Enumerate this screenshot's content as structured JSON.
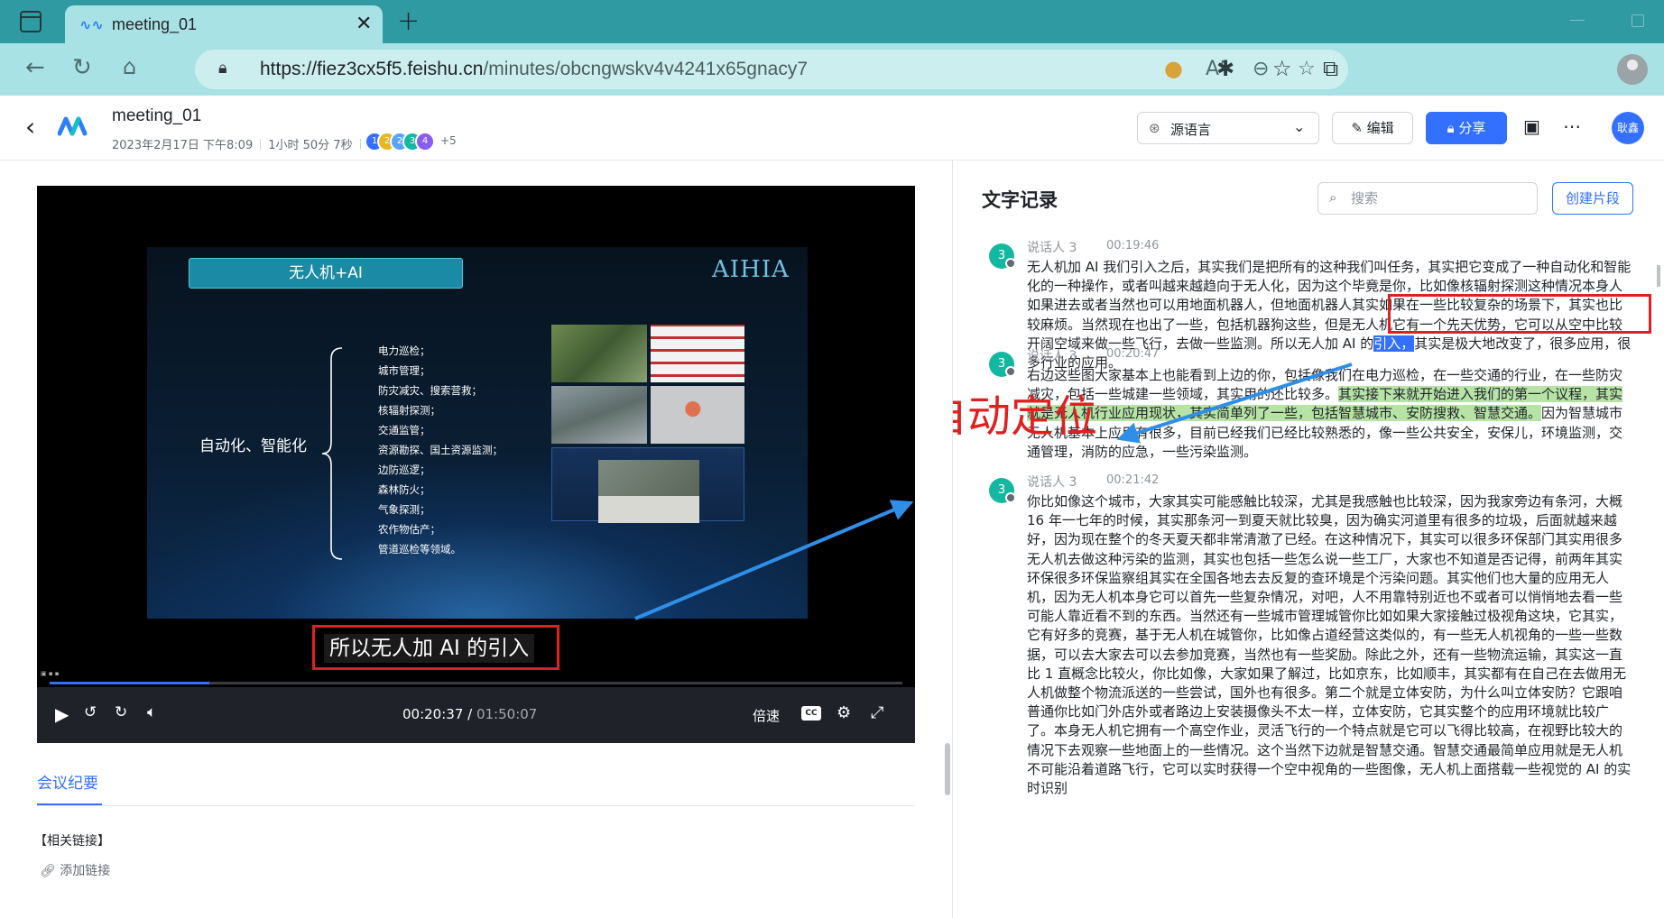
{
  "browser": {
    "tab_title": "meeting_01",
    "url_host": "https://fiez3cx5f5.feishu.cn",
    "url_path": "/minutes/obcngwskv4v4241x65gnacy7",
    "colors": {
      "tabbar": "#2f9aa2",
      "toolbar": "#a9e2e4"
    }
  },
  "header": {
    "title": "meeting_01",
    "date": "2023年2月17日 下午8:09",
    "duration": "1小时 50分 7秒",
    "participants": [
      "1",
      "2",
      "2",
      "3",
      "4"
    ],
    "participants_more": "+5",
    "language_select": "源语言",
    "edit_label": "编辑",
    "share_label": "分享",
    "user_avatar": "耿鑫"
  },
  "player": {
    "slide": {
      "title": "无人机+AI",
      "brand": "AIHIA",
      "main_label": "自动化、智能化",
      "items": [
        "电力巡检；",
        "城市管理；",
        "防灾减灾、搜索营救；",
        "核辐射探测；",
        "交通监管；",
        "资源勘探、国土资源监测；",
        "边防巡逻；",
        "森林防火；",
        "气象探测；",
        "农作物估产；",
        "管道巡检等领域。"
      ]
    },
    "subtitle": "所以无人加 AI 的引入",
    "current_time": "00:20:37",
    "total_time": "01:50:07",
    "progress": 0.187,
    "speed_label": "倍速",
    "cc_label": "CC",
    "accent": "#3370ff"
  },
  "minutes": {
    "tab_label": "会议纪要",
    "related_title": "【相关链接】",
    "add_link": "添加链接"
  },
  "transcript": {
    "title": "文字记录",
    "search_placeholder": "搜索",
    "create_clip": "创建片段",
    "annotation": "自动定位",
    "entries": [
      {
        "speaker": "说话人 3",
        "avatar": "3",
        "time": "00:19:46",
        "text_a": "无人机加 AI 我们引入之后，其实我们是把所有的这种我们叫任务，其实把它变成了一种自动化和智能化的一种操作，或者叫越来越趋向于无人化，因为这个毕竟是你，比如像核辐射探测这种情况本身人如果进去或者当然也可以用地面机器人，但地面机器人其实如果在一些比较复杂的场景下，其实也比较麻烦。当然现在也出了一些，包括机器狗这些，但是无人机它有一个先天优势，它可以从空中比较开阔空域来做一些飞行，去做一些监测。所以无人加 AI 的",
        "highlight": "引入，",
        "text_b": "其实是极大地改变了，很多应用，很多行业的应用。"
      },
      {
        "speaker": "说话人 3",
        "avatar": "3",
        "time": "00:20:47",
        "text_a": "右边这些图大家基本上也能看到上边的你，包括像我们在电力巡检，在一些交通的行业，在一些防灾减灾，包括一些城建一些领域，其实用的还比较多。",
        "highlight": "其实接下来就开始进入我们的第一个议程，其实就是无人机行业应用现状，其实简单列了一些，包括智慧城市、安防搜救、智慧交通。",
        "text_b": "因为智慧城市无人机基本上应用有很多，目前已经我们已经比较熟悉的，像一些公共安全，安保儿，环境监测，交通管理，消防的应急，一些污染监测。"
      },
      {
        "speaker": "说话人 3",
        "avatar": "3",
        "time": "00:21:42",
        "text": "你比如像这个城市，大家其实可能感触比较深，尤其是我感触也比较深，因为我家旁边有条河，大概 16 年一七年的时候，其实那条河一到夏天就比较臭，因为确实河道里有很多的垃圾，后面就越来越好，因为现在整个的冬天夏天都非常清澈了已经。在这种情况下，其实可以很多环保部门其实用很多无人机去做这种污染的监测，其实也包括一些怎么说一些工厂，大家也不知道是否记得，前两年其实环保很多环保监察组其实在全国各地去去反复的查环境是个污染问题。其实他们也大量的应用无人机，因为无人机本身它可以首先一些复杂情况，对吧，人不用靠特别近也不或者可以悄悄地去看一些可能人靠近看不到的东西。当然还有一些城市管理城管你比如如果大家接触过极视角这块，它其实，它有好多的竞赛，基于无人机在城管你，比如像占道经营这类似的，有一些无人机视角的一些一些数据，可以去大家去可以去参加竞赛，当然也有一些奖励。除此之外，还有一些物流运输，其实这一直比 1 直概念比较火，你比如像，大家如果了解过，比如京东，比如顺丰，其实都有在自己在去做用无人机做整个物流派送的一些尝试，国外也有很多。第二个就是立体安防，为什么叫立体安防？它跟咱普通你比如门外店外或者路边上安装摄像头不太一样，立体安防，它其实整个的应用环境就比较广了。本身无人机它拥有一个高空作业，灵活飞行的一个特点就是它可以飞得比较高，在视野比较大的情况下去观察一些地面上的一些情况。这个当然下边就是智慧交通。智慧交通最简单应用就是无人机不可能沿着道路飞行，它可以实时获得一个空中视角的一些图像，无人机上面搭载一些视觉的 AI 的实时识别"
      }
    ]
  }
}
